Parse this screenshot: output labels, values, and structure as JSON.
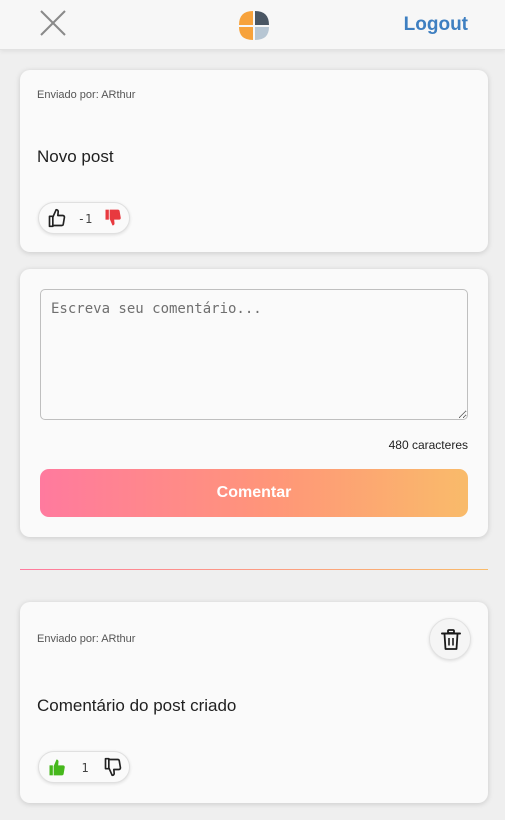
{
  "colors": {
    "brand_blue": "#3e7fc1",
    "gradient_start": "#ff7a9e",
    "gradient_mid": "#ff9678",
    "gradient_end": "#f9bb6a",
    "like_active": "#46b81c",
    "dislike_active": "#e8393f"
  },
  "header": {
    "close_icon": "close-icon",
    "logo_icon": "brand-logo",
    "logout_label": "Logout"
  },
  "post": {
    "author_line": "Enviado por: ARthur",
    "text": "Novo post",
    "votes": {
      "count": "-1",
      "like_state": "inactive",
      "dislike_state": "active",
      "like_icon": "thumbs-up-icon",
      "dislike_icon": "thumbs-down-icon"
    }
  },
  "comment_form": {
    "placeholder": "Escreva seu comentário...",
    "value": "",
    "char_counter": "480 caracteres",
    "submit_label": "Comentar"
  },
  "comments": [
    {
      "author_line": "Enviado por: ARthur",
      "text": "Comentário do post criado",
      "delete_icon": "trash-icon",
      "votes": {
        "count": "1",
        "like_state": "active",
        "dislike_state": "inactive",
        "like_icon": "thumbs-up-icon",
        "dislike_icon": "thumbs-down-icon"
      }
    }
  ]
}
